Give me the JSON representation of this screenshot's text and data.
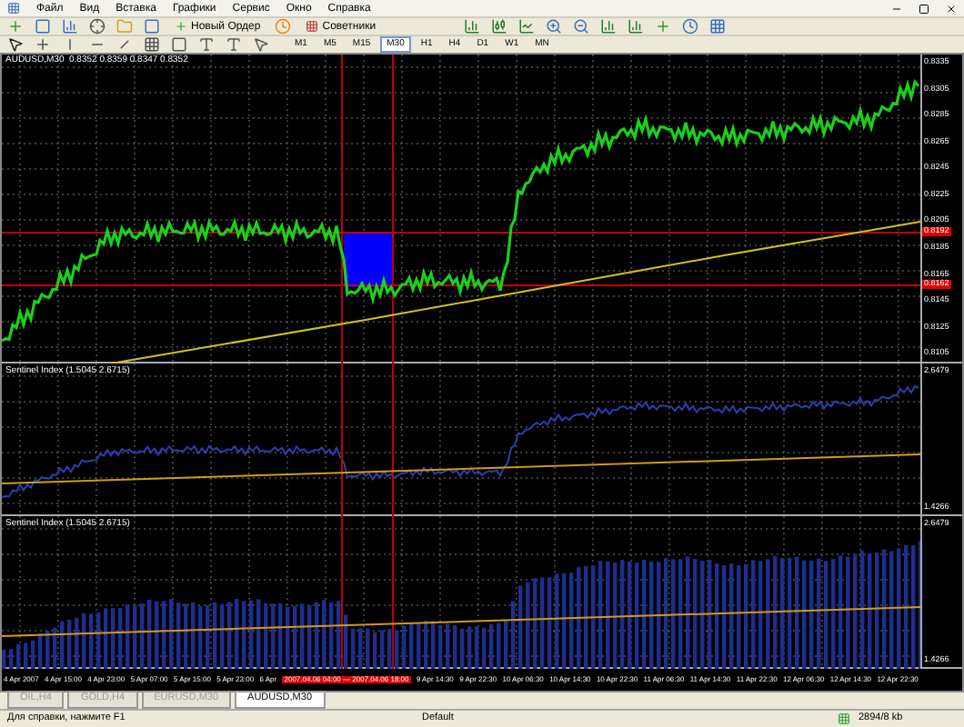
{
  "menu": [
    "Файл",
    "Вид",
    "Вставка",
    "Графики",
    "Сервис",
    "Окно",
    "Справка"
  ],
  "toolbar": {
    "order_button": "Новый Ордер",
    "experts_button": "Советники"
  },
  "timeframes": [
    {
      "label": "M1",
      "selected": false
    },
    {
      "label": "M5",
      "selected": false
    },
    {
      "label": "M15",
      "selected": false
    },
    {
      "label": "M30",
      "selected": true
    },
    {
      "label": "H1",
      "selected": false
    },
    {
      "label": "H4",
      "selected": false
    },
    {
      "label": "D1",
      "selected": false
    },
    {
      "label": "W1",
      "selected": false
    },
    {
      "label": "MN",
      "selected": false
    }
  ],
  "chart": {
    "title": "AUDUSD,M30  0.8352 0.8359 0.8347 0.8352",
    "price_labels": [
      "0.8335",
      "0.8305",
      "0.8285",
      "0.8265",
      "0.8245",
      "0.8225",
      "0.8205",
      "0.8185",
      "0.8165",
      "0.8145",
      "0.8125",
      "0.8105"
    ],
    "price_markers": [
      "0.8192",
      "0.8162"
    ]
  },
  "indicators": [
    {
      "title": "Sentinel Index (1.5045 2.6715)",
      "kind": "line",
      "top_label": "2.6479",
      "bottom_label": "1.4266"
    },
    {
      "title": "Sentinel Index (1.5045 2.6715)",
      "kind": "histogram",
      "top_label": "2.6479",
      "bottom_label": "1.4266"
    }
  ],
  "time_axis": [
    {
      "label": "4 Apr 2007",
      "kind": "tick"
    },
    {
      "label": "4 Apr 15:00",
      "kind": "tick"
    },
    {
      "label": "4 Apr 23:00",
      "kind": "tick"
    },
    {
      "label": "5 Apr 07:00",
      "kind": "tick"
    },
    {
      "label": "5 Apr 15:00",
      "kind": "tick"
    },
    {
      "label": "5 Apr 23:00",
      "kind": "tick"
    },
    {
      "label": "6 Apr",
      "kind": "tick"
    },
    {
      "label": "2007.04.06 04:00 — 2007.04.06 18:00",
      "kind": "range"
    },
    {
      "label": "9 Apr 14:30",
      "kind": "tick"
    },
    {
      "label": "9 Apr 22:30",
      "kind": "tick"
    },
    {
      "label": "10 Apr 06:30",
      "kind": "tick"
    },
    {
      "label": "10 Apr 14:30",
      "kind": "tick"
    },
    {
      "label": "10 Apr 22:30",
      "kind": "tick"
    },
    {
      "label": "11 Apr 06:30",
      "kind": "tick"
    },
    {
      "label": "11 Apr 14:30",
      "kind": "tick"
    },
    {
      "label": "11 Apr 22:30",
      "kind": "tick"
    },
    {
      "label": "12 Apr 06:30",
      "kind": "tick"
    },
    {
      "label": "12 Apr 14:30",
      "kind": "tick"
    },
    {
      "label": "12 Apr 22:30",
      "kind": "tick"
    }
  ],
  "tabs": [
    {
      "label": "OIL,H4",
      "selected": false
    },
    {
      "label": "GOLD,H4",
      "selected": false
    },
    {
      "label": "EURUSD,M30",
      "selected": false
    },
    {
      "label": "AUDUSD,M30",
      "selected": true
    }
  ],
  "status_bar": {
    "help": "Для справки, нажмите F1",
    "profile": "Default",
    "traffic": "2894/8 kb"
  }
}
